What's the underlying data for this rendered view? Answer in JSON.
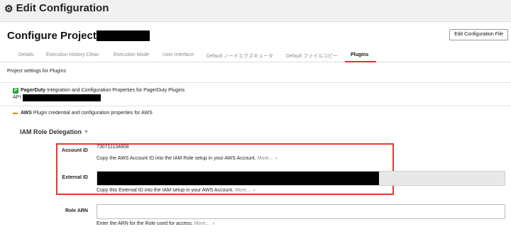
{
  "header": {
    "icon": "gear-icon",
    "title": "Edit Configuration"
  },
  "project": {
    "title_prefix": "Configure Project:",
    "edit_file_button": "Edit Configuration File"
  },
  "tabs": [
    {
      "label": "Details",
      "active": false
    },
    {
      "label": "Execution History Clean",
      "active": false
    },
    {
      "label": "Execution Mode",
      "active": false
    },
    {
      "label": "User Interface",
      "active": false
    },
    {
      "label": "Default ノードエクズキュータ",
      "active": false
    },
    {
      "label": "Default ファイルコピー",
      "active": false
    },
    {
      "label": "Plugins",
      "active": true
    }
  ],
  "settings_label": "Project settings for Plugins",
  "plugins": {
    "pagerduty": {
      "badge": "P",
      "name": "PagerDuty",
      "description": "Integration and Configuration Properties for PagerDuty Plugins",
      "api_label": "API"
    },
    "aws": {
      "icon": "aws-icon",
      "name": "AWS",
      "description": "Plugin credential and configuration properties for AWS"
    }
  },
  "iam_section": {
    "title": "IAM Role Delegation",
    "account_id": {
      "label": "Account ID",
      "value": "730711134808",
      "help": "Copy the AWS Account ID into the IAM Role setup in your AWS Account.",
      "more": "More..."
    },
    "external_id": {
      "label": "External ID",
      "help": "Copy this External ID into the IAM setup in your AWS Account.",
      "more": "More..."
    },
    "role_arn": {
      "label": "Role ARN",
      "value": "",
      "help": "Enter the ARN for the Role used for access.",
      "more": "More..."
    }
  },
  "colors": {
    "highlight": "#e8382b",
    "active_tab_underline": "#dd3333",
    "pagerduty_green": "#26a33a"
  }
}
